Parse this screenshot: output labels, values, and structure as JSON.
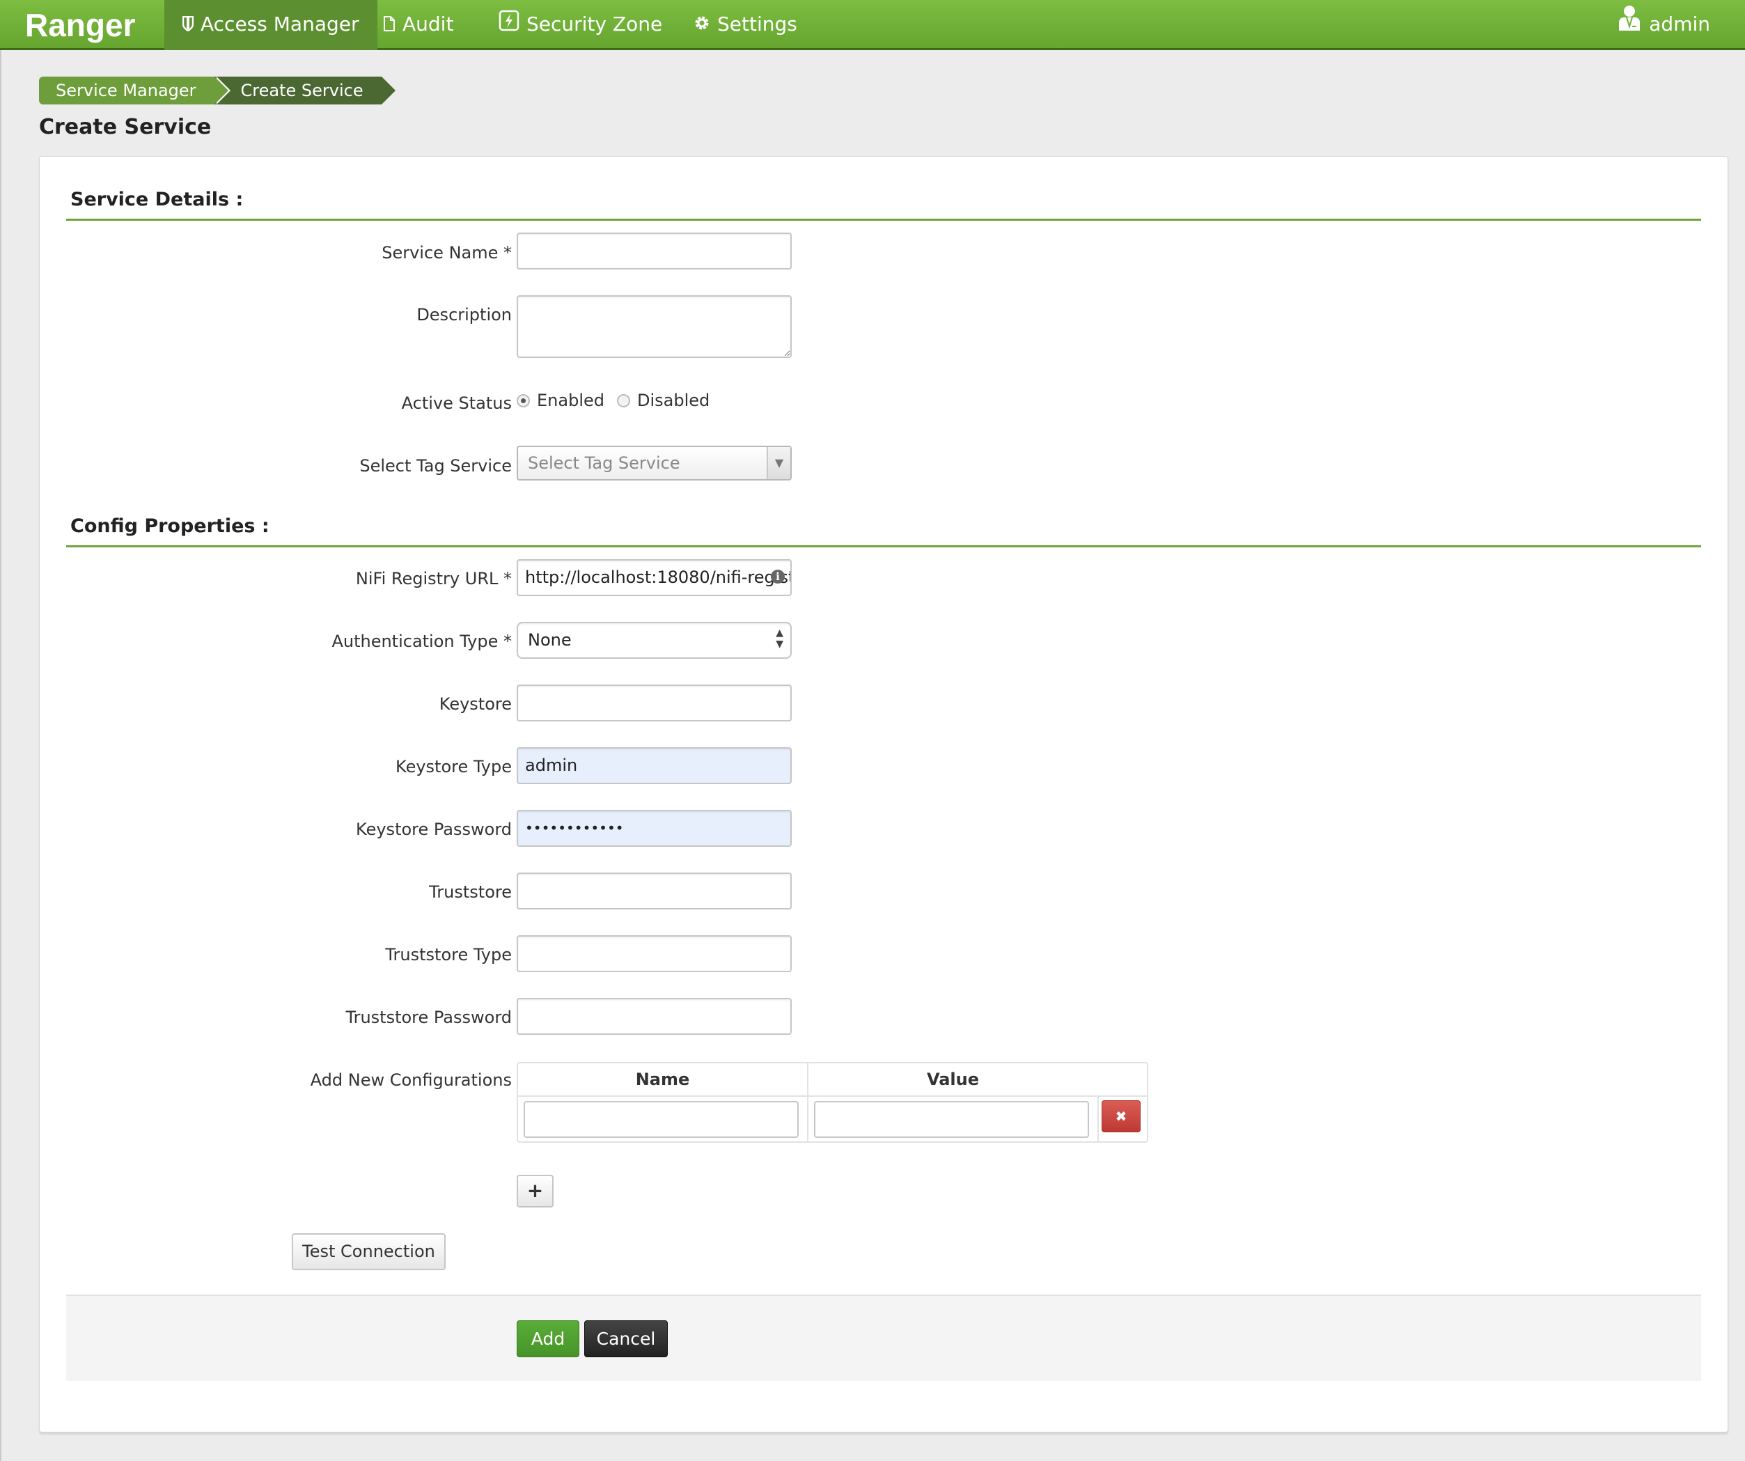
{
  "navbar": {
    "brand": "Ranger",
    "items": [
      {
        "label": "Access Manager",
        "icon": "shield-icon",
        "active": true
      },
      {
        "label": "Audit",
        "icon": "file-icon",
        "active": false
      },
      {
        "label": "Security Zone",
        "icon": "lightning-icon",
        "active": false
      },
      {
        "label": "Settings",
        "icon": "gear-icon",
        "active": false
      }
    ],
    "user": {
      "label": "admin",
      "icon": "user-icon"
    }
  },
  "breadcrumb": [
    "Service Manager",
    "Create Service"
  ],
  "page_title": "Create Service",
  "service_details": {
    "title": "Service Details :",
    "service_name": {
      "label": "Service Name *",
      "value": ""
    },
    "description": {
      "label": "Description",
      "value": ""
    },
    "active_status": {
      "label": "Active Status",
      "options": [
        "Enabled",
        "Disabled"
      ],
      "selected": "Enabled"
    },
    "tag_service": {
      "label": "Select Tag Service",
      "placeholder": "Select Tag Service"
    }
  },
  "config_properties": {
    "title": "Config Properties :",
    "nifi_url": {
      "label": "NiFi Registry URL *",
      "value": "http://localhost:18080/nifi-regist",
      "icon": "info-icon"
    },
    "auth_type": {
      "label": "Authentication Type *",
      "value": "None"
    },
    "keystore": {
      "label": "Keystore",
      "value": ""
    },
    "keystore_type": {
      "label": "Keystore Type",
      "value": "admin"
    },
    "keystore_password": {
      "label": "Keystore Password",
      "value": "••••••••••••"
    },
    "truststore": {
      "label": "Truststore",
      "value": ""
    },
    "truststore_type": {
      "label": "Truststore Type",
      "value": ""
    },
    "truststore_password": {
      "label": "Truststore Password",
      "value": ""
    },
    "new_configs": {
      "label": "Add New Configurations",
      "columns": [
        "Name",
        "Value"
      ],
      "rows": [
        {
          "name": "",
          "value": ""
        }
      ],
      "delete_label": "✖",
      "add_label": "+"
    }
  },
  "buttons": {
    "test_connection": "Test Connection",
    "add": "Add",
    "cancel": "Cancel"
  },
  "colors": {
    "nav_green": "#6eb13a",
    "nav_active": "#5b8f2f",
    "section_line": "#6ea53a",
    "add_button": "#4f9e2f",
    "delete_button": "#c9433d"
  }
}
